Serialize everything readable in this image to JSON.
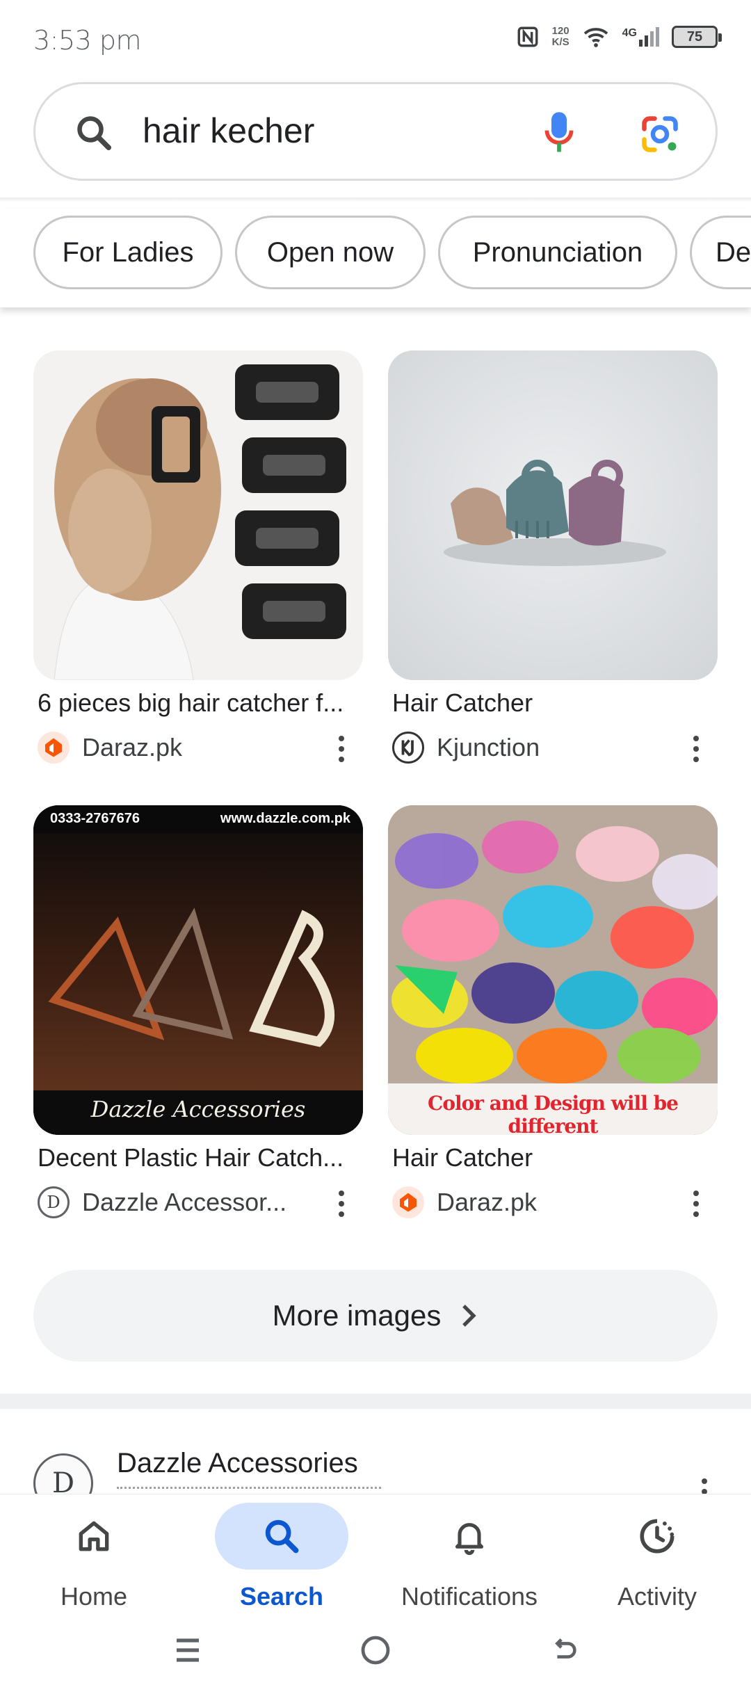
{
  "status_bar": {
    "time": "3:53 pm",
    "speed_value": "120",
    "speed_unit": "K/S",
    "network": "4G",
    "battery": "75"
  },
  "search": {
    "query": "hair kecher"
  },
  "chips": [
    {
      "label": "For Ladies"
    },
    {
      "label": "Open now"
    },
    {
      "label": "Pronunciation"
    },
    {
      "label": "De"
    }
  ],
  "images": [
    {
      "title": "6 pieces big hair catcher f...",
      "source": "Daraz.pk",
      "favicon": "daraz-icon"
    },
    {
      "title": "Hair Catcher",
      "source": "Kjunction",
      "favicon": "kjunction-icon"
    },
    {
      "title": "Decent Plastic Hair Catch...",
      "source": "Dazzle Accessor...",
      "favicon": "dazzle-icon",
      "overlay_phone": "0333-2767676",
      "overlay_url": "www.dazzle.com.pk",
      "overlay_brand": "Dazzle Accessories"
    },
    {
      "title": "Hair Catcher",
      "source": "Daraz.pk",
      "favicon": "daraz-icon",
      "overlay_caption": "Color and Design will be different"
    }
  ],
  "more_images": {
    "label": "More images"
  },
  "result": {
    "title": "Dazzle Accessories",
    "favicon_letter": "D"
  },
  "bottom_nav": {
    "items": [
      {
        "label": "Home",
        "icon": "home-icon"
      },
      {
        "label": "Search",
        "icon": "search-icon",
        "active": true
      },
      {
        "label": "Notifications",
        "icon": "bell-icon"
      },
      {
        "label": "Activity",
        "icon": "activity-icon"
      }
    ]
  },
  "colors": {
    "accent": "#0b57d0",
    "active_pill": "#d3e3fd",
    "daraz_orange": "#f85606"
  }
}
